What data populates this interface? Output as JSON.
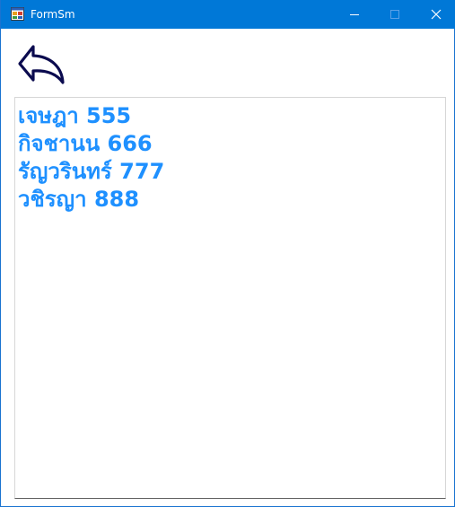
{
  "window": {
    "title": "FormSm",
    "app_icon": "winforms-app-icon",
    "controls": {
      "minimize_icon": "minimize-icon",
      "maximize_icon": "maximize-icon",
      "close_icon": "close-icon"
    },
    "titlebar_color": "#0078d7"
  },
  "toolbar": {
    "back_icon": "reply-back-arrow-icon",
    "back_icon_color": "#0b0b4f"
  },
  "listbox": {
    "text_color": "#1e90ff",
    "items": [
      "เจษฎา 555",
      "กิจชานน 666",
      "รัญวรินทร์ 777",
      "วชิรญา 888"
    ]
  }
}
